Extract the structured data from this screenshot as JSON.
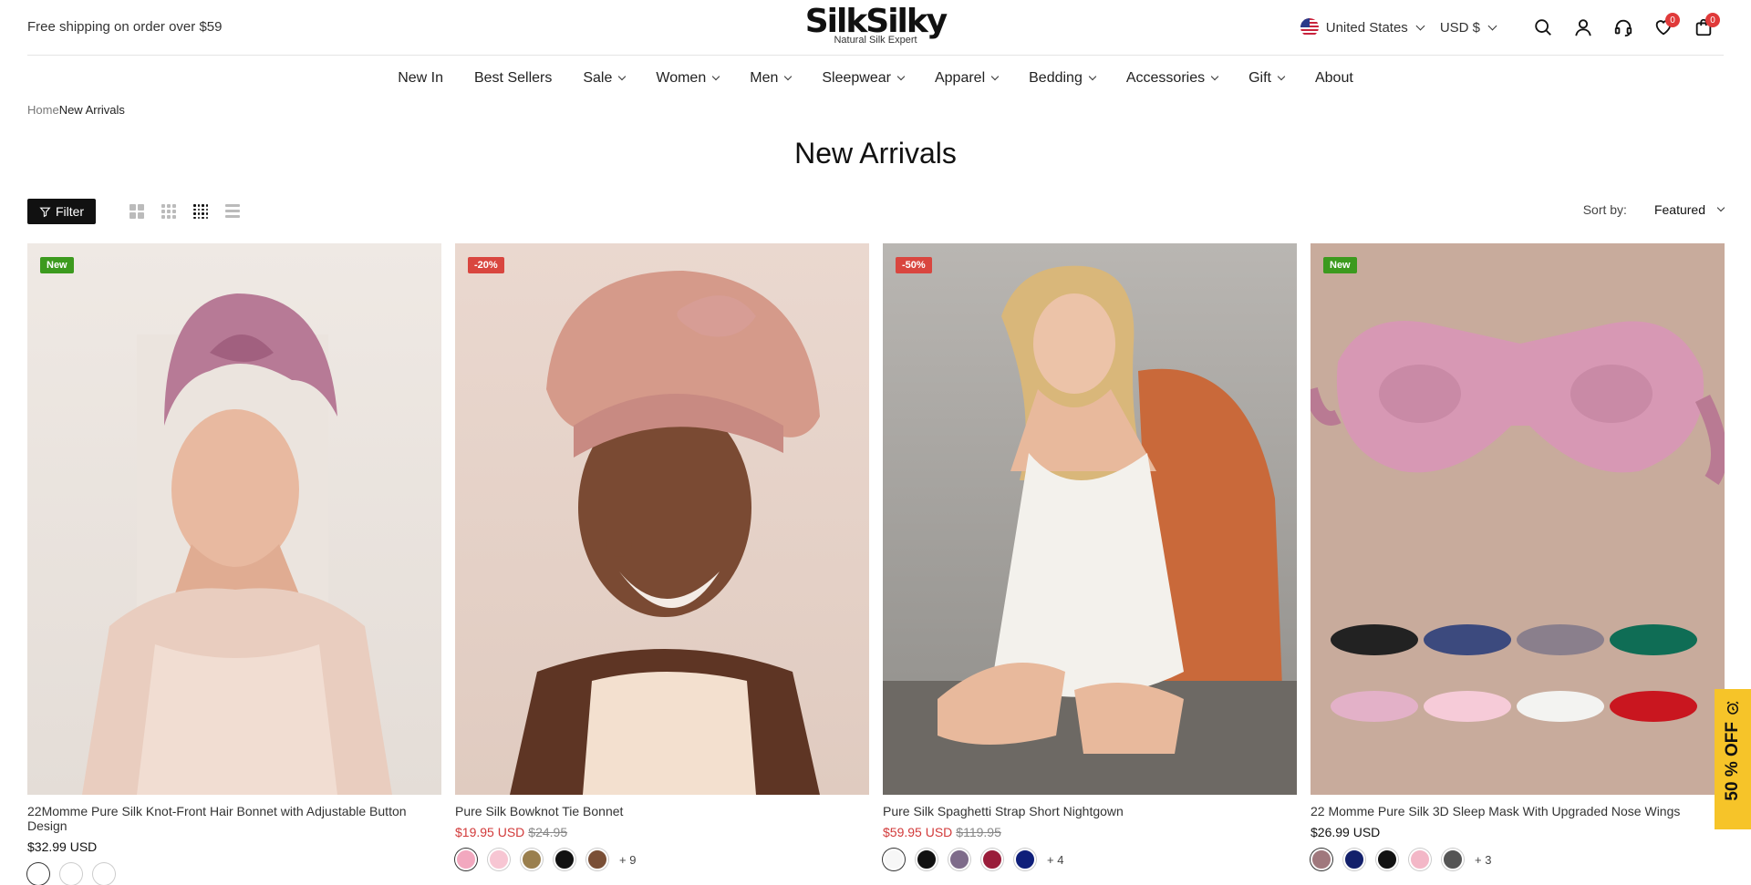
{
  "announcement": "Free shipping on order over $59",
  "logo": {
    "brand": "SilkSilky",
    "tagline": "Natural Silk Expert"
  },
  "locale": {
    "country": "United States",
    "currency": "USD $"
  },
  "header_icons": {
    "wishlist_count": "0",
    "cart_count": "0"
  },
  "nav": [
    "New In",
    "Best Sellers",
    "Sale",
    "Women",
    "Men",
    "Sleepwear",
    "Apparel",
    "Bedding",
    "Accessories",
    "Gift",
    "About"
  ],
  "breadcrumb": {
    "home": "Home",
    "current": "New Arrivals"
  },
  "page_title": "New Arrivals",
  "toolbar": {
    "filter": "Filter",
    "sort_label": "Sort by:",
    "sort_value": "Featured"
  },
  "products": [
    {
      "tag": "New",
      "tag_color": "#3c9a1e",
      "name": "22Momme Pure Silk Knot-Front Hair Bonnet with Adjustable Button Design",
      "price": "$32.99 USD",
      "old_price": "",
      "swatches": [
        "#ffffff",
        "#ffffff",
        "#ffffff"
      ],
      "more": ""
    },
    {
      "tag": "-20%",
      "tag_color": "#d9463f",
      "name": "Pure Silk Bowknot Tie Bonnet",
      "price": "$19.95 USD",
      "old_price": "$24.95",
      "swatches": [
        "#f2a8bf",
        "#f7c6d3",
        "#9a7f4e",
        "#111111",
        "#7a4f36"
      ],
      "more": "+ 9"
    },
    {
      "tag": "-50%",
      "tag_color": "#d9463f",
      "name": "Pure Silk Spaghetti Strap Short Nightgown",
      "price": "$59.95 USD",
      "old_price": "$119.95",
      "swatches": [
        "#f7f7f7",
        "#111111",
        "#7e6b8a",
        "#9a1d3a",
        "#0f1f7a"
      ],
      "more": "+ 4"
    },
    {
      "tag": "New",
      "tag_color": "#3c9a1e",
      "name": "22 Momme Pure Silk 3D Sleep Mask With Upgraded Nose Wings",
      "price": "$26.99 USD",
      "old_price": "",
      "swatches": [
        "#a0787d",
        "#13206b",
        "#111111",
        "#f3b7c7",
        "#555555"
      ],
      "more": "+ 3"
    }
  ],
  "promo": "50 % OFF"
}
